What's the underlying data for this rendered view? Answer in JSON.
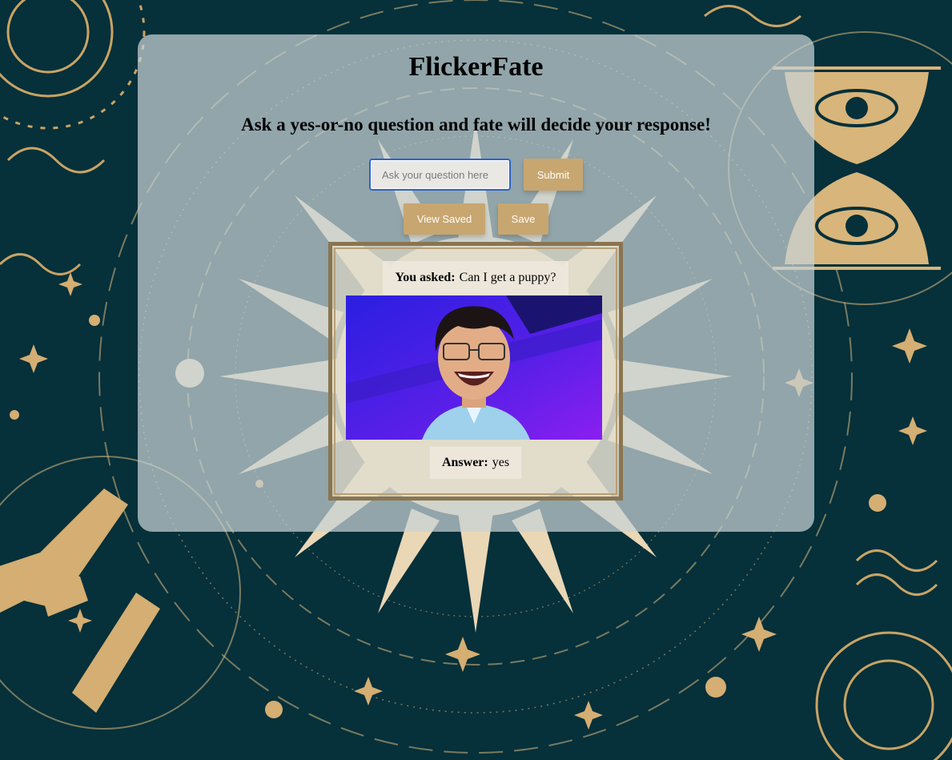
{
  "app": {
    "title": "FlickerFate",
    "subtitle": "Ask a yes-or-no question and fate will decide your response!"
  },
  "form": {
    "question_placeholder": "Ask your question here",
    "question_value": "",
    "submit_label": "Submit",
    "view_saved_label": "View Saved",
    "save_label": "Save"
  },
  "result": {
    "asked_label": "You asked:",
    "question": "Can I get a puppy?",
    "answer_label": "Answer:",
    "answer": "yes"
  },
  "theme": {
    "background": "#06303a",
    "accent_gold": "#c8a670",
    "panel": "#c8d2d6",
    "frame": "#8a7550"
  },
  "icons": [
    "sun-illustration",
    "eye-hourglass-illustration",
    "hands-illustration",
    "moon-icon",
    "star-icon"
  ]
}
